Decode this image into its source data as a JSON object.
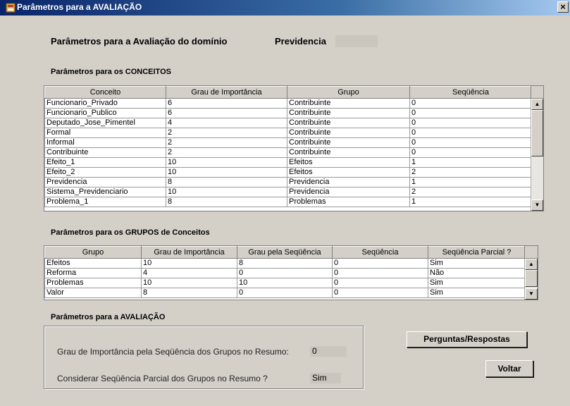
{
  "window": {
    "title": "Parâmetros para a AVALIAÇÃO",
    "close_label": "×"
  },
  "header": {
    "title": "Parâmetros para a Avaliação do domínio",
    "domain": "Previdencia"
  },
  "concepts": {
    "section_title": "Parâmetros para os CONCEITOS",
    "columns": [
      "Conceito",
      "Grau de Importância",
      "Grupo",
      "Seqüência"
    ],
    "rows": [
      [
        "Funcionario_Privado",
        "6",
        "Contribuinte",
        "0"
      ],
      [
        "Funcionario_Publico",
        "6",
        "Contribuinte",
        "0"
      ],
      [
        "Deputado_Jose_Pimentel",
        "4",
        "Contribuinte",
        "0"
      ],
      [
        "Formal",
        "2",
        "Contribuinte",
        "0"
      ],
      [
        "Informal",
        "2",
        "Contribuinte",
        "0"
      ],
      [
        "Contribuinte",
        "2",
        "Contribuinte",
        "0"
      ],
      [
        "Efeito_1",
        "10",
        "Efeitos",
        "1"
      ],
      [
        "Efeito_2",
        "10",
        "Efeitos",
        "2"
      ],
      [
        "Previdencia",
        "8",
        "Previdencia",
        "1"
      ],
      [
        "Sistema_Previdenciario",
        "10",
        "Previdencia",
        "2"
      ],
      [
        "Problema_1",
        "8",
        "Problemas",
        "1"
      ]
    ]
  },
  "groups": {
    "section_title": "Parâmetros para os GRUPOS de Conceitos",
    "columns": [
      "Grupo",
      "Grau de Importância",
      "Grau pela Seqüência",
      "Seqüência",
      "Seqüência Parcial ?"
    ],
    "rows": [
      [
        "Efeitos",
        "10",
        "8",
        "0",
        "Sim"
      ],
      [
        "Reforma",
        "4",
        "0",
        "0",
        "Não"
      ],
      [
        "Problemas",
        "10",
        "10",
        "0",
        "Sim"
      ],
      [
        "Valor",
        "8",
        "0",
        "0",
        "Sim"
      ]
    ]
  },
  "evaluation": {
    "section_title": "Parâmetros para a AVALIAÇÃO",
    "seq_weight_label": "Grau de Importância pela Seqüência dos Grupos no Resumo:",
    "seq_weight_value": "0",
    "partial_label": "Considerar Seqüência Parcial dos Grupos no Resumo ?",
    "partial_value": "Sim"
  },
  "buttons": {
    "questions": "Perguntas/Respostas",
    "back": "Voltar"
  },
  "icons": {
    "app": "app-icon",
    "scroll_up": "arrow-up-icon",
    "scroll_down": "arrow-down-icon"
  }
}
